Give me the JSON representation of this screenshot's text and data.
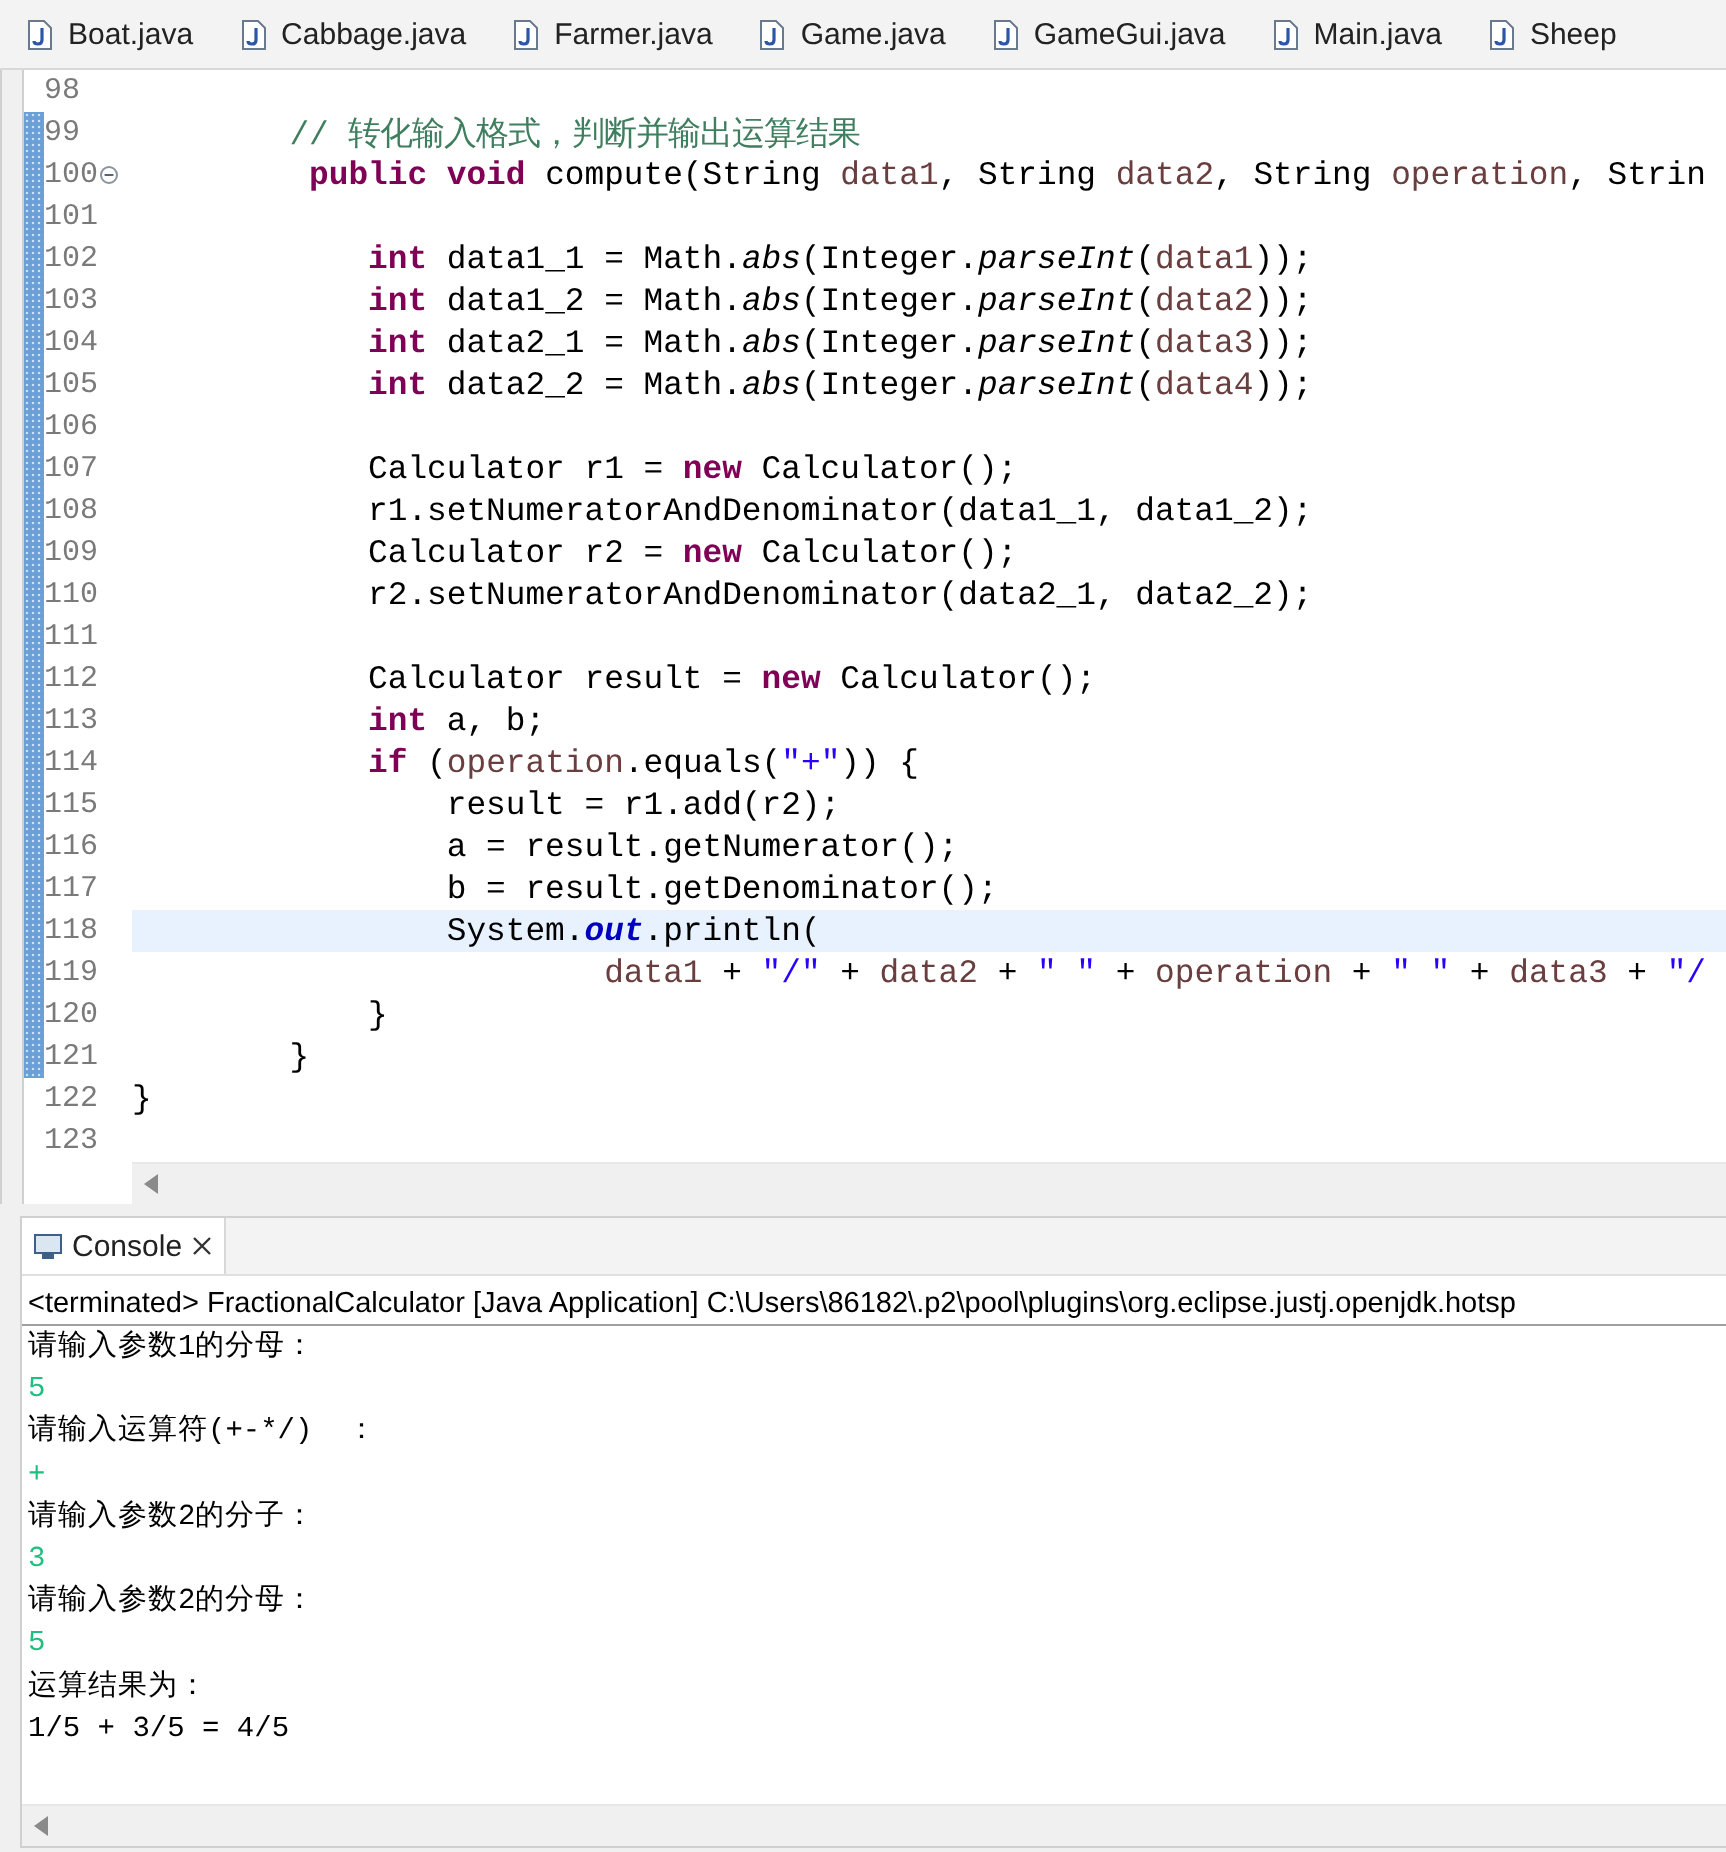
{
  "tabs": [
    {
      "label": "Boat.java",
      "selected": false
    },
    {
      "label": "Cabbage.java",
      "selected": false
    },
    {
      "label": "Farmer.java",
      "selected": false
    },
    {
      "label": "Game.java",
      "selected": false
    },
    {
      "label": "GameGui.java",
      "selected": false
    },
    {
      "label": "Main.java",
      "selected": false
    },
    {
      "label": "Sheep",
      "selected": false
    }
  ],
  "editor": {
    "lines": [
      {
        "number": "98",
        "changed": false,
        "current": false,
        "foldable": false
      },
      {
        "number": "99",
        "changed": true,
        "current": false,
        "foldable": false,
        "tokens": [
          {
            "kind": "comment",
            "text": "        // 转化输入格式，判断并输出运算结果"
          }
        ]
      },
      {
        "number": "100",
        "changed": true,
        "current": false,
        "foldable": true,
        "tokens": [
          {
            "kind": "keyword",
            "text": "         public void"
          },
          {
            "kind": "plain",
            "text": " compute(String "
          },
          {
            "kind": "var",
            "text": "data1"
          },
          {
            "kind": "plain",
            "text": ", String "
          },
          {
            "kind": "var",
            "text": "data2"
          },
          {
            "kind": "plain",
            "text": ", String "
          },
          {
            "kind": "var",
            "text": "operation"
          },
          {
            "kind": "plain",
            "text": ", Strin"
          }
        ]
      },
      {
        "number": "101",
        "changed": true,
        "current": false,
        "foldable": false
      },
      {
        "number": "102",
        "changed": true,
        "current": false,
        "foldable": false,
        "tokens": [
          {
            "kind": "keyword",
            "text": "            int"
          },
          {
            "kind": "plain",
            "text": " data1_1 = Math."
          },
          {
            "kind": "static",
            "text": "abs"
          },
          {
            "kind": "plain",
            "text": "(Integer."
          },
          {
            "kind": "static",
            "text": "parseInt"
          },
          {
            "kind": "plain",
            "text": "("
          },
          {
            "kind": "var",
            "text": "data1"
          },
          {
            "kind": "plain",
            "text": "));"
          }
        ]
      },
      {
        "number": "103",
        "changed": true,
        "current": false,
        "foldable": false,
        "tokens": [
          {
            "kind": "keyword",
            "text": "            int"
          },
          {
            "kind": "plain",
            "text": " data1_2 = Math."
          },
          {
            "kind": "static",
            "text": "abs"
          },
          {
            "kind": "plain",
            "text": "(Integer."
          },
          {
            "kind": "static",
            "text": "parseInt"
          },
          {
            "kind": "plain",
            "text": "("
          },
          {
            "kind": "var",
            "text": "data2"
          },
          {
            "kind": "plain",
            "text": "));"
          }
        ]
      },
      {
        "number": "104",
        "changed": true,
        "current": false,
        "foldable": false,
        "tokens": [
          {
            "kind": "keyword",
            "text": "            int"
          },
          {
            "kind": "plain",
            "text": " data2_1 = Math."
          },
          {
            "kind": "static",
            "text": "abs"
          },
          {
            "kind": "plain",
            "text": "(Integer."
          },
          {
            "kind": "static",
            "text": "parseInt"
          },
          {
            "kind": "plain",
            "text": "("
          },
          {
            "kind": "var",
            "text": "data3"
          },
          {
            "kind": "plain",
            "text": "));"
          }
        ]
      },
      {
        "number": "105",
        "changed": true,
        "current": false,
        "foldable": false,
        "tokens": [
          {
            "kind": "keyword",
            "text": "            int"
          },
          {
            "kind": "plain",
            "text": " data2_2 = Math."
          },
          {
            "kind": "static",
            "text": "abs"
          },
          {
            "kind": "plain",
            "text": "(Integer."
          },
          {
            "kind": "static",
            "text": "parseInt"
          },
          {
            "kind": "plain",
            "text": "("
          },
          {
            "kind": "var",
            "text": "data4"
          },
          {
            "kind": "plain",
            "text": "));"
          }
        ]
      },
      {
        "number": "106",
        "changed": true,
        "current": false,
        "foldable": false
      },
      {
        "number": "107",
        "changed": true,
        "current": false,
        "foldable": false,
        "tokens": [
          {
            "kind": "plain",
            "text": "            Calculator r1 = "
          },
          {
            "kind": "keyword",
            "text": "new"
          },
          {
            "kind": "plain",
            "text": " Calculator();"
          }
        ]
      },
      {
        "number": "108",
        "changed": true,
        "current": false,
        "foldable": false,
        "tokens": [
          {
            "kind": "plain",
            "text": "            r1.setNumeratorAndDenominator(data1_1, data1_2);"
          }
        ]
      },
      {
        "number": "109",
        "changed": true,
        "current": false,
        "foldable": false,
        "tokens": [
          {
            "kind": "plain",
            "text": "            Calculator r2 = "
          },
          {
            "kind": "keyword",
            "text": "new"
          },
          {
            "kind": "plain",
            "text": " Calculator();"
          }
        ]
      },
      {
        "number": "110",
        "changed": true,
        "current": false,
        "foldable": false,
        "tokens": [
          {
            "kind": "plain",
            "text": "            r2.setNumeratorAndDenominator(data2_1, data2_2);"
          }
        ]
      },
      {
        "number": "111",
        "changed": true,
        "current": false,
        "foldable": false
      },
      {
        "number": "112",
        "changed": true,
        "current": false,
        "foldable": false,
        "tokens": [
          {
            "kind": "plain",
            "text": "            Calculator result = "
          },
          {
            "kind": "keyword",
            "text": "new"
          },
          {
            "kind": "plain",
            "text": " Calculator();"
          }
        ]
      },
      {
        "number": "113",
        "changed": true,
        "current": false,
        "foldable": false,
        "tokens": [
          {
            "kind": "keyword",
            "text": "            int"
          },
          {
            "kind": "plain",
            "text": " a, b;"
          }
        ]
      },
      {
        "number": "114",
        "changed": true,
        "current": false,
        "foldable": false,
        "tokens": [
          {
            "kind": "keyword",
            "text": "            if"
          },
          {
            "kind": "plain",
            "text": " ("
          },
          {
            "kind": "var",
            "text": "operation"
          },
          {
            "kind": "plain",
            "text": ".equals("
          },
          {
            "kind": "string",
            "text": "\"+\""
          },
          {
            "kind": "plain",
            "text": ")) {"
          }
        ]
      },
      {
        "number": "115",
        "changed": true,
        "current": false,
        "foldable": false,
        "tokens": [
          {
            "kind": "plain",
            "text": "                result = r1.add(r2);"
          }
        ]
      },
      {
        "number": "116",
        "changed": true,
        "current": false,
        "foldable": false,
        "tokens": [
          {
            "kind": "plain",
            "text": "                a = result.getNumerator();"
          }
        ]
      },
      {
        "number": "117",
        "changed": true,
        "current": false,
        "foldable": false,
        "tokens": [
          {
            "kind": "plain",
            "text": "                b = result.getDenominator();"
          }
        ]
      },
      {
        "number": "118",
        "changed": true,
        "current": true,
        "foldable": false,
        "tokens": [
          {
            "kind": "plain",
            "text": "                System."
          },
          {
            "kind": "field",
            "text": "out"
          },
          {
            "kind": "plain",
            "text": ".println("
          }
        ]
      },
      {
        "number": "119",
        "changed": true,
        "current": false,
        "foldable": false,
        "tokens": [
          {
            "kind": "var",
            "text": "                        data1"
          },
          {
            "kind": "plain",
            "text": " + "
          },
          {
            "kind": "string",
            "text": "\"/\""
          },
          {
            "kind": "plain",
            "text": " + "
          },
          {
            "kind": "var",
            "text": "data2"
          },
          {
            "kind": "plain",
            "text": " + "
          },
          {
            "kind": "string",
            "text": "\" \""
          },
          {
            "kind": "plain",
            "text": " + "
          },
          {
            "kind": "var",
            "text": "operation"
          },
          {
            "kind": "plain",
            "text": " + "
          },
          {
            "kind": "string",
            "text": "\" \""
          },
          {
            "kind": "plain",
            "text": " + "
          },
          {
            "kind": "var",
            "text": "data3"
          },
          {
            "kind": "plain",
            "text": " + "
          },
          {
            "kind": "string",
            "text": "\"/"
          }
        ]
      },
      {
        "number": "120",
        "changed": true,
        "current": false,
        "foldable": false,
        "tokens": [
          {
            "kind": "plain",
            "text": "            }"
          }
        ]
      },
      {
        "number": "121",
        "changed": true,
        "current": false,
        "foldable": false,
        "tokens": [
          {
            "kind": "plain",
            "text": "        }"
          }
        ]
      },
      {
        "number": "122",
        "changed": false,
        "current": false,
        "foldable": false,
        "tokens": [
          {
            "kind": "plain",
            "text": "}"
          }
        ]
      },
      {
        "number": "123",
        "changed": false,
        "current": false,
        "foldable": false
      }
    ]
  },
  "console": {
    "tab": {
      "label": "Console",
      "selected": true
    },
    "header": "<terminated> FractionalCalculator [Java Application] C:\\Users\\86182\\.p2\\pool\\plugins\\org.eclipse.justj.openjdk.hotsp",
    "lines": [
      {
        "kind": "output",
        "text": "请输入参数1的分母："
      },
      {
        "kind": "input",
        "text": "5"
      },
      {
        "kind": "output",
        "text": "请输入运算符(+-*/)  ："
      },
      {
        "kind": "input",
        "text": "+"
      },
      {
        "kind": "output",
        "text": "请输入参数2的分子："
      },
      {
        "kind": "input",
        "text": "3"
      },
      {
        "kind": "output",
        "text": "请输入参数2的分母："
      },
      {
        "kind": "input",
        "text": "5"
      },
      {
        "kind": "output",
        "text": "运算结果为："
      },
      {
        "kind": "output",
        "text": "1/5 + 3/5 = 4/5"
      }
    ]
  }
}
